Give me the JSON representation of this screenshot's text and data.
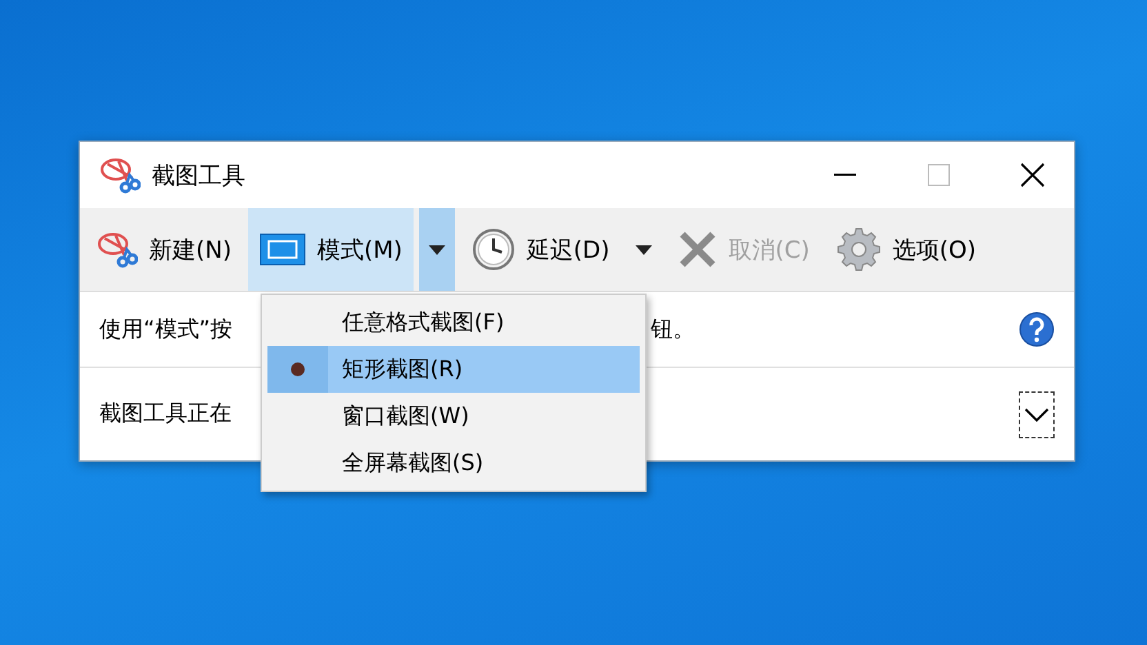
{
  "window": {
    "title": "截图工具"
  },
  "toolbar": [
    {
      "kind": "new",
      "label": "新建(N)",
      "disabled": false,
      "selected": false
    },
    {
      "kind": "mode",
      "label": "模式(M)",
      "disabled": false,
      "selected": true
    },
    {
      "kind": "delay",
      "label": "延迟(D)",
      "disabled": false,
      "selected": false
    },
    {
      "kind": "cancel",
      "label": "取消(C)",
      "disabled": true,
      "selected": false
    },
    {
      "kind": "options",
      "label": "选项(O)",
      "disabled": false,
      "selected": false
    }
  ],
  "hint_line": {
    "before": "使用“模式”按",
    "after": "钮。"
  },
  "status_line": {
    "before": "截图工具正在"
  },
  "mode_menu": [
    {
      "label": "任意格式截图(F)",
      "selected": false
    },
    {
      "label": "矩形截图(R)",
      "selected": true
    },
    {
      "label": "窗口截图(W)",
      "selected": false
    },
    {
      "label": "全屏幕截图(S)",
      "selected": false
    }
  ]
}
